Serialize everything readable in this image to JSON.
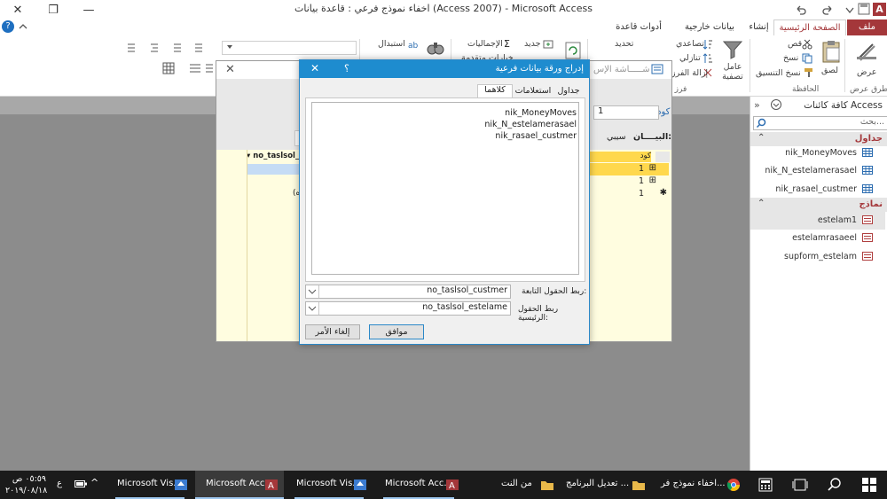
{
  "window": {
    "title": "اخفاء نموذج فرعي : قاعدة بيانات (Access 2007) - Microsoft Access",
    "minimize": "—",
    "restore": "❐",
    "close": "✕"
  },
  "quick_access": {
    "app_badge": "A"
  },
  "ribbon_tabs": {
    "file": "ملف",
    "home": "الصفحة الرئيسية",
    "create": "إنشاء",
    "external": "بيانات خارجية",
    "dbtools": "أدوات قاعدة البيانات"
  },
  "ribbon": {
    "views_label": "عرض",
    "views_group": "طرق عرض",
    "cut": "قص",
    "copy": "نسخ",
    "paste": "لصق",
    "format_painter": "نسخ التنسيق",
    "clipboard_group": "الحافظة",
    "filter": "عامل تصفية",
    "ascending": "تصاعدي",
    "descending": "تنازلي",
    "remove_sort": "إزالة الفرز",
    "refresh": "تحديد",
    "sort_group": "فرز وت",
    "new_record": "جديد",
    "totals": "الإجماليات",
    "replace": "استبدال",
    "advanced": "خيارات متقدمة"
  },
  "bgform": {
    "code_label": "كود",
    "code_value": "1",
    "data_label": "البيــــان:",
    "data_value": "سيبي",
    "dlg_shadow_title": "شـــــاشة الإس",
    "col_header_left": "no_taslsol_",
    "col_header_right": "كود",
    "rows": [
      {
        "value": "1"
      },
      {
        "value": "1"
      },
      {
        "value": "1"
      }
    ],
    "plus": "⊞",
    "asterisk": "✱",
    "misc": "(ه"
  },
  "dialog": {
    "title": "إدراج ورقة بيانات فرعية",
    "help": "؟",
    "close": "✕",
    "tabs": {
      "tables": "جداول",
      "queries": "استعلامات",
      "both": "كلاهما"
    },
    "list_items": [
      "nik_MoneyMoves",
      "nik_N_estelamerasael",
      "nik_rasael_custmer"
    ],
    "child_label": "ربط الحقول التابعة:",
    "child_value": "no_taslsol_custmer",
    "master_label": "ربط الحقول الرئيسية:",
    "master_value": "no_taslsol_estelame",
    "ok": "موافق",
    "cancel": "إلغاء الأمر"
  },
  "nav": {
    "title": "كافة كائنات Access",
    "search_placeholder": "بحث...",
    "tables_header": "جداول",
    "tables": [
      "nik_MoneyMoves",
      "nik_N_estelamerasael",
      "nik_rasael_custmer"
    ],
    "forms_header": "نماذج",
    "forms": [
      "estelam1",
      "estelamrasaeel",
      "supform_estelam"
    ]
  },
  "taskbar": {
    "items": [
      {
        "label": "اخفاء نموذج فر..."
      },
      {
        "label": "تعديل البرنامج ..."
      },
      {
        "label": "من النت"
      },
      {
        "label": "Microsoft Acc..."
      },
      {
        "label": "Microsoft Vis..."
      },
      {
        "label": "Microsoft Acc..."
      },
      {
        "label": "Microsoft Vis..."
      }
    ],
    "lang": "ع",
    "time": "٠٥:٥٩ ص",
    "date": "٢٠١٩/٠٨/١٨"
  },
  "colors": {
    "access_red": "#a4373a",
    "dialog_blue": "#1e8ccf",
    "taskbar": "#1b1b1b",
    "active_task": "#3a3a3a"
  }
}
